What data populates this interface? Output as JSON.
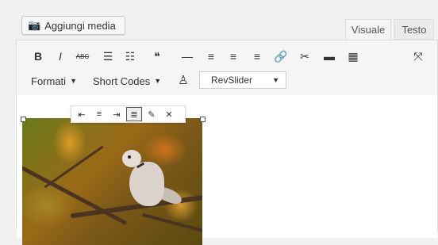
{
  "media": {
    "label": "Aggiungi media",
    "icon": "media-icon"
  },
  "tabs": [
    {
      "label": "Visuale",
      "active": true
    },
    {
      "label": "Testo",
      "active": false
    }
  ],
  "toolbar": {
    "row1": [
      {
        "name": "bold-button",
        "glyph": "B"
      },
      {
        "name": "italic-button",
        "glyph": "I"
      },
      {
        "name": "strikethrough-button",
        "glyph": "ABC"
      },
      {
        "name": "bullet-list-button",
        "glyph": "☰"
      },
      {
        "name": "numbered-list-button",
        "glyph": "☷"
      },
      {
        "name": "blockquote-button",
        "glyph": "❝"
      },
      {
        "name": "horizontal-line-button",
        "glyph": "—"
      },
      {
        "name": "align-left-button",
        "glyph": "≡"
      },
      {
        "name": "align-center-button",
        "glyph": "≡"
      },
      {
        "name": "align-right-button",
        "glyph": "≡"
      },
      {
        "name": "link-button",
        "glyph": "🔗"
      },
      {
        "name": "unlink-button",
        "glyph": "✂"
      },
      {
        "name": "read-more-button",
        "glyph": "▬"
      },
      {
        "name": "toolbar-toggle-button",
        "glyph": "▦"
      }
    ],
    "fullscreen_glyph": "⤧",
    "formats_label": "Formati",
    "shortcodes_label": "Short Codes",
    "revslider_label": "RevSlider"
  },
  "image_toolbar": [
    {
      "name": "align-left-image-button",
      "glyph": "⇤",
      "active": false
    },
    {
      "name": "align-center-image-button",
      "glyph": "≡",
      "active": false
    },
    {
      "name": "align-right-image-button",
      "glyph": "⇥",
      "active": false
    },
    {
      "name": "align-none-image-button",
      "glyph": "≣",
      "active": true
    },
    {
      "name": "edit-image-button",
      "glyph": "✎",
      "active": false
    },
    {
      "name": "remove-image-button",
      "glyph": "✕",
      "active": false
    }
  ],
  "colors": {
    "accent": "#f1f1f1",
    "toolbar": "#f5f5f5",
    "border": "#dcdcdc"
  }
}
